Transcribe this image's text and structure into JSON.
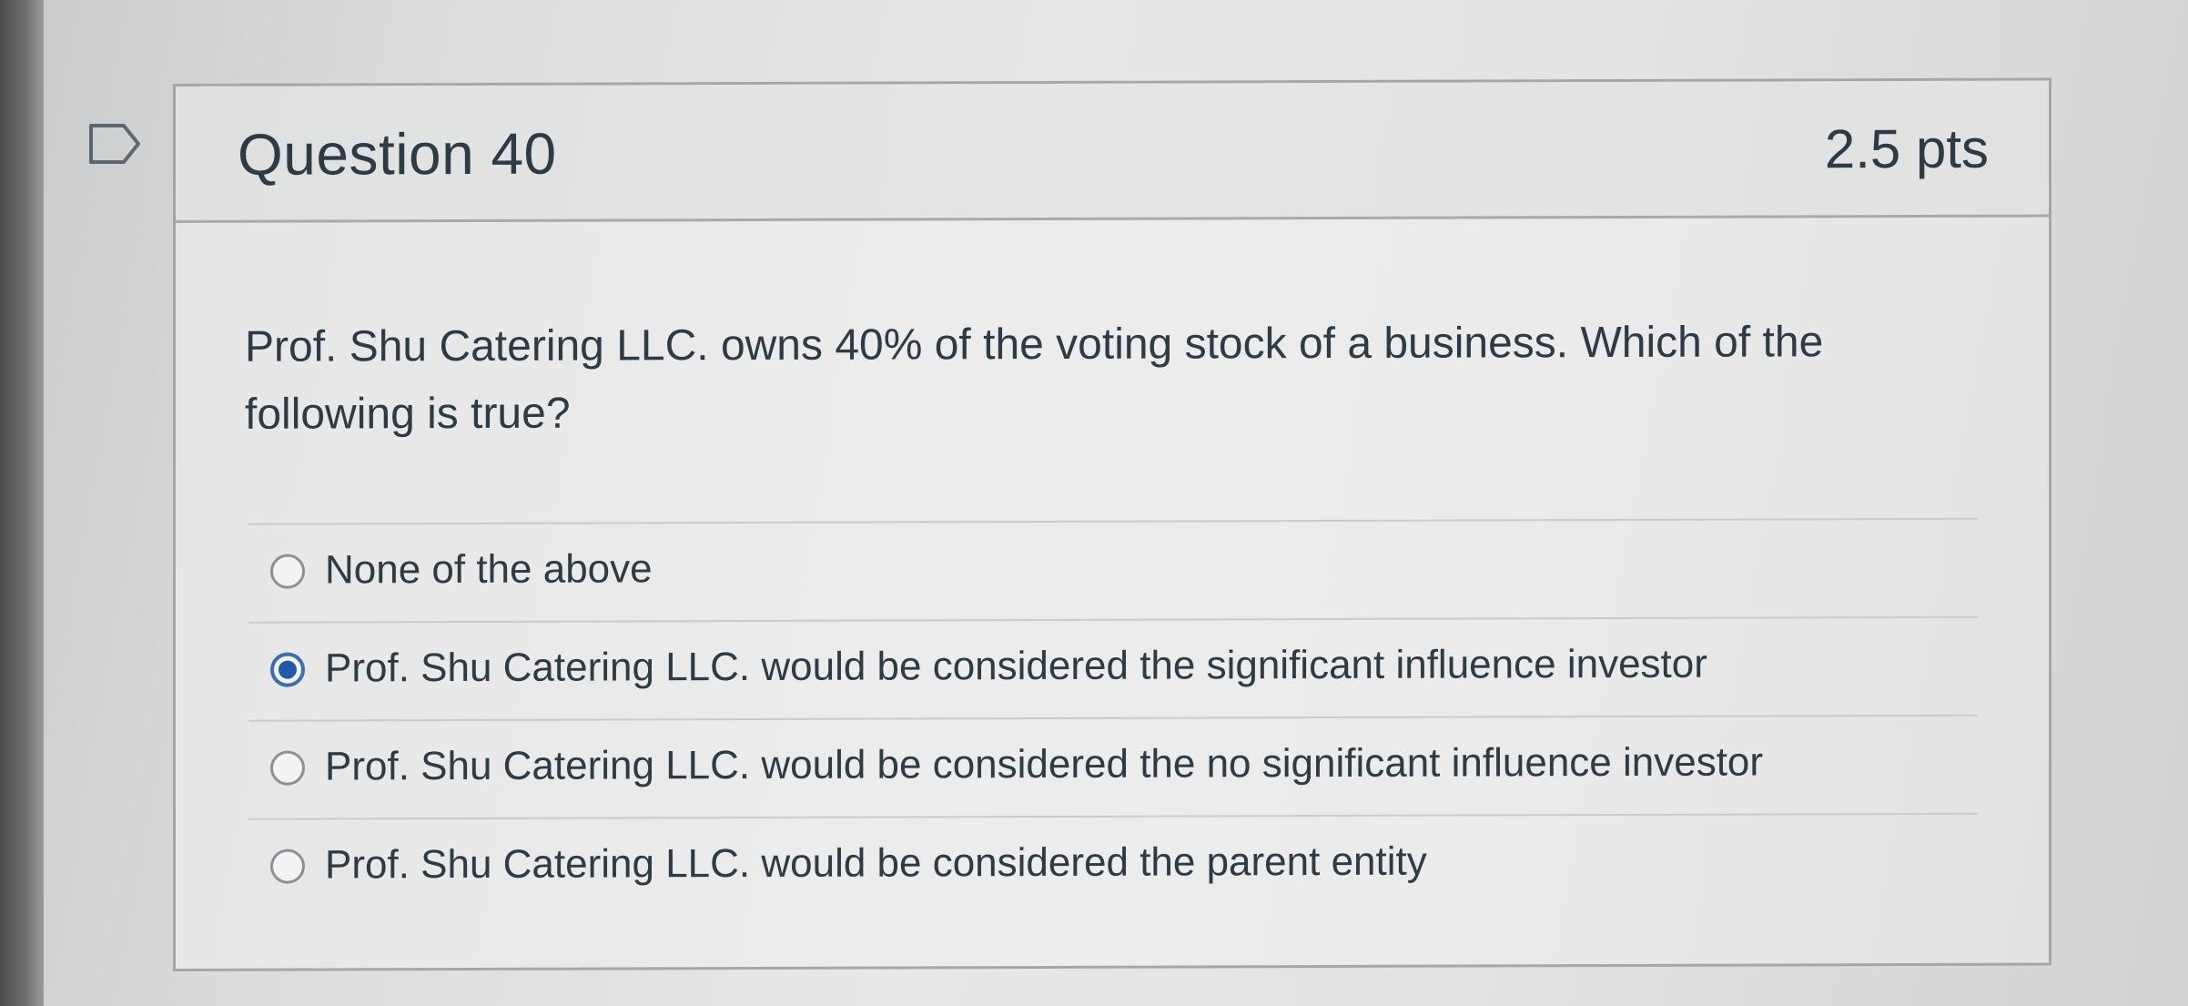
{
  "question": {
    "title": "Question 40",
    "points": "2.5 pts",
    "text": "Prof. Shu Catering LLC. owns 40% of the voting stock of a business. Which of the following is true?",
    "flag_icon": "flag-outline-icon",
    "answers": [
      {
        "label": "None of the above",
        "selected": false
      },
      {
        "label": "Prof. Shu Catering LLC. would be considered the significant influence investor",
        "selected": true
      },
      {
        "label": "Prof. Shu Catering LLC. would be considered the no significant influence investor",
        "selected": false
      },
      {
        "label": "Prof. Shu Catering LLC. would be considered the parent entity",
        "selected": false
      }
    ]
  },
  "colors": {
    "text": "#2d3b45",
    "radio_selected": "#1e5aa8",
    "border": "#a4a6a8"
  }
}
